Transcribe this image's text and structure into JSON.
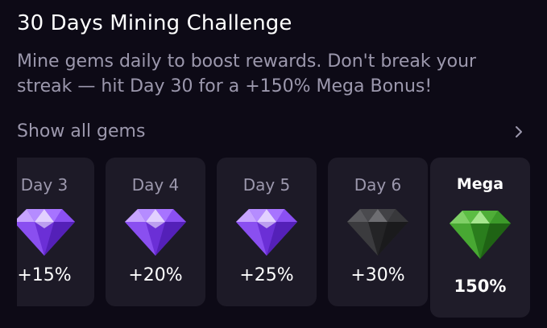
{
  "header": {
    "title": "30 Days Mining Challenge",
    "subtitle": "Mine gems daily to boost rewards. Don't break your streak — hit Day 30 for a +150% Mega Bonus!"
  },
  "gems_link": {
    "label": "Show all gems",
    "icon": "chevron-right-icon"
  },
  "cards": [
    {
      "day": "Day 3",
      "bonus": "+15%",
      "gem": "purple-gem-icon"
    },
    {
      "day": "Day 4",
      "bonus": "+20%",
      "gem": "purple-gem-icon"
    },
    {
      "day": "Day 5",
      "bonus": "+25%",
      "gem": "purple-gem-icon"
    },
    {
      "day": "Day 6",
      "bonus": "+30%",
      "gem": "black-gem-icon"
    },
    {
      "day": "Mega",
      "bonus": "150%",
      "gem": "green-gem-icon"
    }
  ],
  "colors": {
    "background": "#0d0a16",
    "card": "#1d1a27",
    "muted_text": "#9c98ad",
    "purple_gem": "#9b5cf0",
    "black_gem": "#3a3a3c",
    "green_gem": "#3fa32d"
  }
}
